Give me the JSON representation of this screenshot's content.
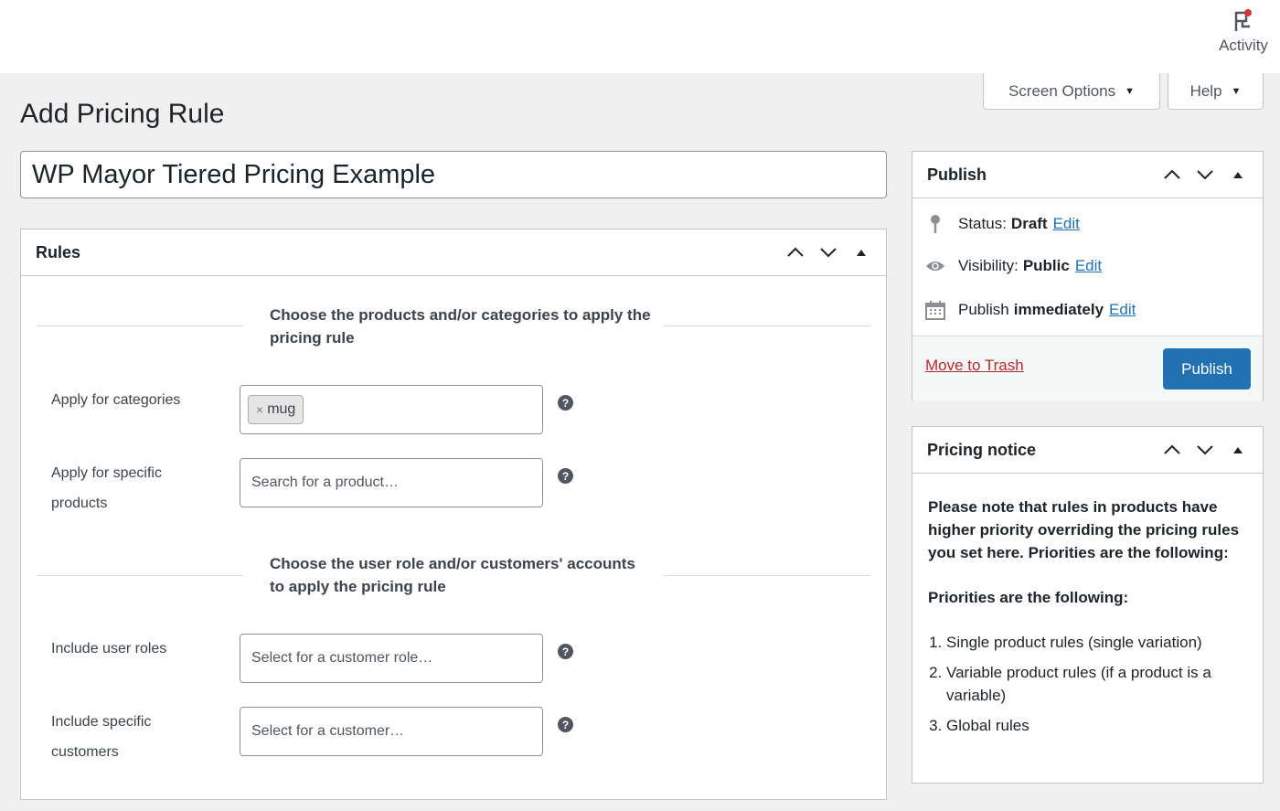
{
  "topbar": {
    "activity_label": "Activity",
    "activity_icon": "activity-flag-icon",
    "notification_color": "#d63638"
  },
  "tabs": {
    "screen_options": "Screen Options",
    "help": "Help"
  },
  "page": {
    "title": "Add Pricing Rule"
  },
  "rule_title": {
    "value": "WP Mayor Tiered Pricing Example"
  },
  "rules": {
    "heading": "Rules",
    "section_products": "Choose the products and/or categories to apply the pricing rule",
    "section_users": "Choose the user role and/or customers' accounts to apply the pricing rule",
    "categories": {
      "label": "Apply for categories",
      "tags": [
        "mug"
      ],
      "tag_remove": "×"
    },
    "products": {
      "label": "Apply for specific products",
      "placeholder": "Search for a product…"
    },
    "roles": {
      "label": "Include user roles",
      "placeholder": "Select for a customer role…"
    },
    "customers": {
      "label": "Include specific customers",
      "placeholder": "Select for a customer…"
    },
    "help_glyph": "?"
  },
  "publish": {
    "heading": "Publish",
    "status_label": "Status:",
    "status_value": "Draft",
    "visibility_label": "Visibility:",
    "visibility_value": "Public",
    "schedule_label": "Publish",
    "schedule_value": "immediately",
    "edit_label": "Edit",
    "trash_label": "Move to Trash",
    "publish_button": "Publish",
    "accent_color": "#2271b1",
    "trash_color": "#b32d2e"
  },
  "notice": {
    "heading": "Pricing notice",
    "paragraph": "Please note that rules in products have higher priority overriding the pricing rules you set here. Priorities are the following:",
    "subheading": "Priorities are the following:",
    "items": [
      "Single product rules (single variation)",
      "Variable product rules (if a product is a variable)",
      "Global rules"
    ]
  }
}
